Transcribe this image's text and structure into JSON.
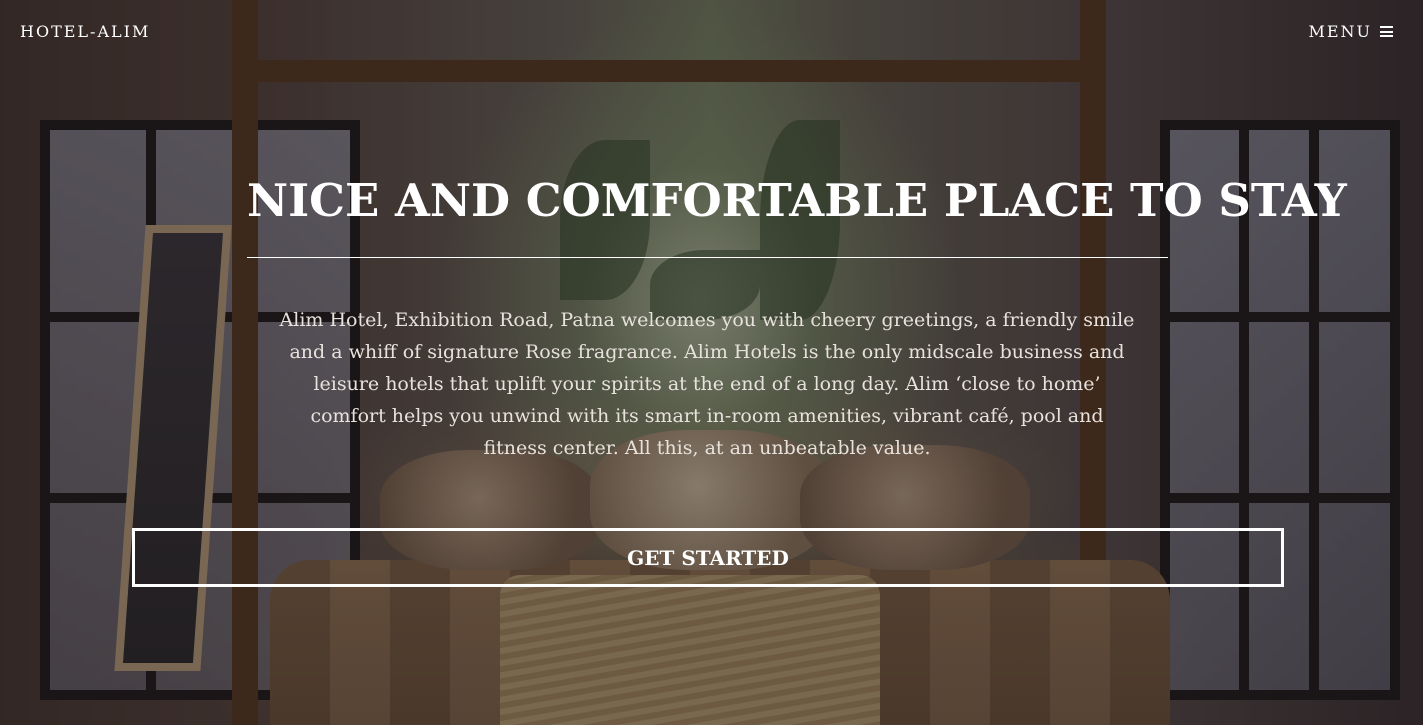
{
  "nav": {
    "brand": "HOTEL-ALIM",
    "menu_label": "MENU"
  },
  "hero": {
    "headline": "NICE AND COMFORTABLE PLACE TO STAY",
    "intro": "Alim Hotel, Exhibition Road, Patna welcomes you with cheery greetings, a friendly smile and a whiff of signature Rose fragrance. Alim Hotels is the only midscale business and leisure hotels that uplift your spirits at the end of a long day. Alim ‘close to home’ comfort helps you unwind with its smart in-room amenities, vibrant café, pool and fitness center. All this, at an unbeatable value.",
    "cta_label": "GET STARTED"
  },
  "icons": {
    "menu": "hamburger-icon"
  },
  "colors": {
    "text": "#ffffff",
    "overlay": "rgba(25, 18, 20, 0.45)"
  }
}
